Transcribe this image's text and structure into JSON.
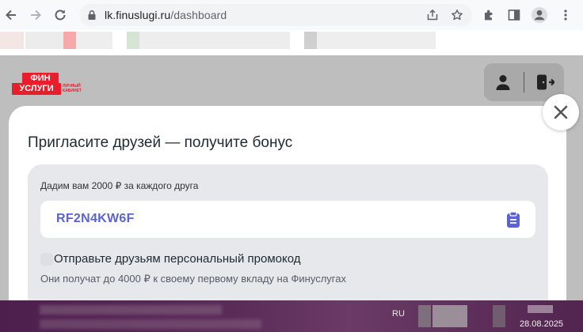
{
  "browser": {
    "url_host": "lk.finuslugi.ru",
    "url_path": "/dashboard",
    "icons": [
      "back-icon",
      "forward-icon",
      "reload-icon",
      "site-info-icon",
      "share-icon",
      "star-icon",
      "extensions-icon",
      "side-panel-icon",
      "profile-icon",
      "menu-icon"
    ]
  },
  "site": {
    "logo_line1": "ФИН",
    "logo_line2": "УСЛУГИ",
    "logo_sub": "ЛИЧНЫЙ КАБИНЕТ",
    "brand_color": "#ea1d2c"
  },
  "modal": {
    "title": "Пригласите друзей — получите бонус",
    "caption": "Дадим вам 2000 ₽ за каждого друга",
    "promo_code": "RF2N4KW6F",
    "step_title": "Отправьте друзьям персональный промокод",
    "step_desc": "Они получат до 4000 ₽ к своему первому вкладу на Финуслугах",
    "accent_color": "#5b63d3"
  },
  "taskbar": {
    "language": "RU",
    "date": "28.08.2025"
  }
}
